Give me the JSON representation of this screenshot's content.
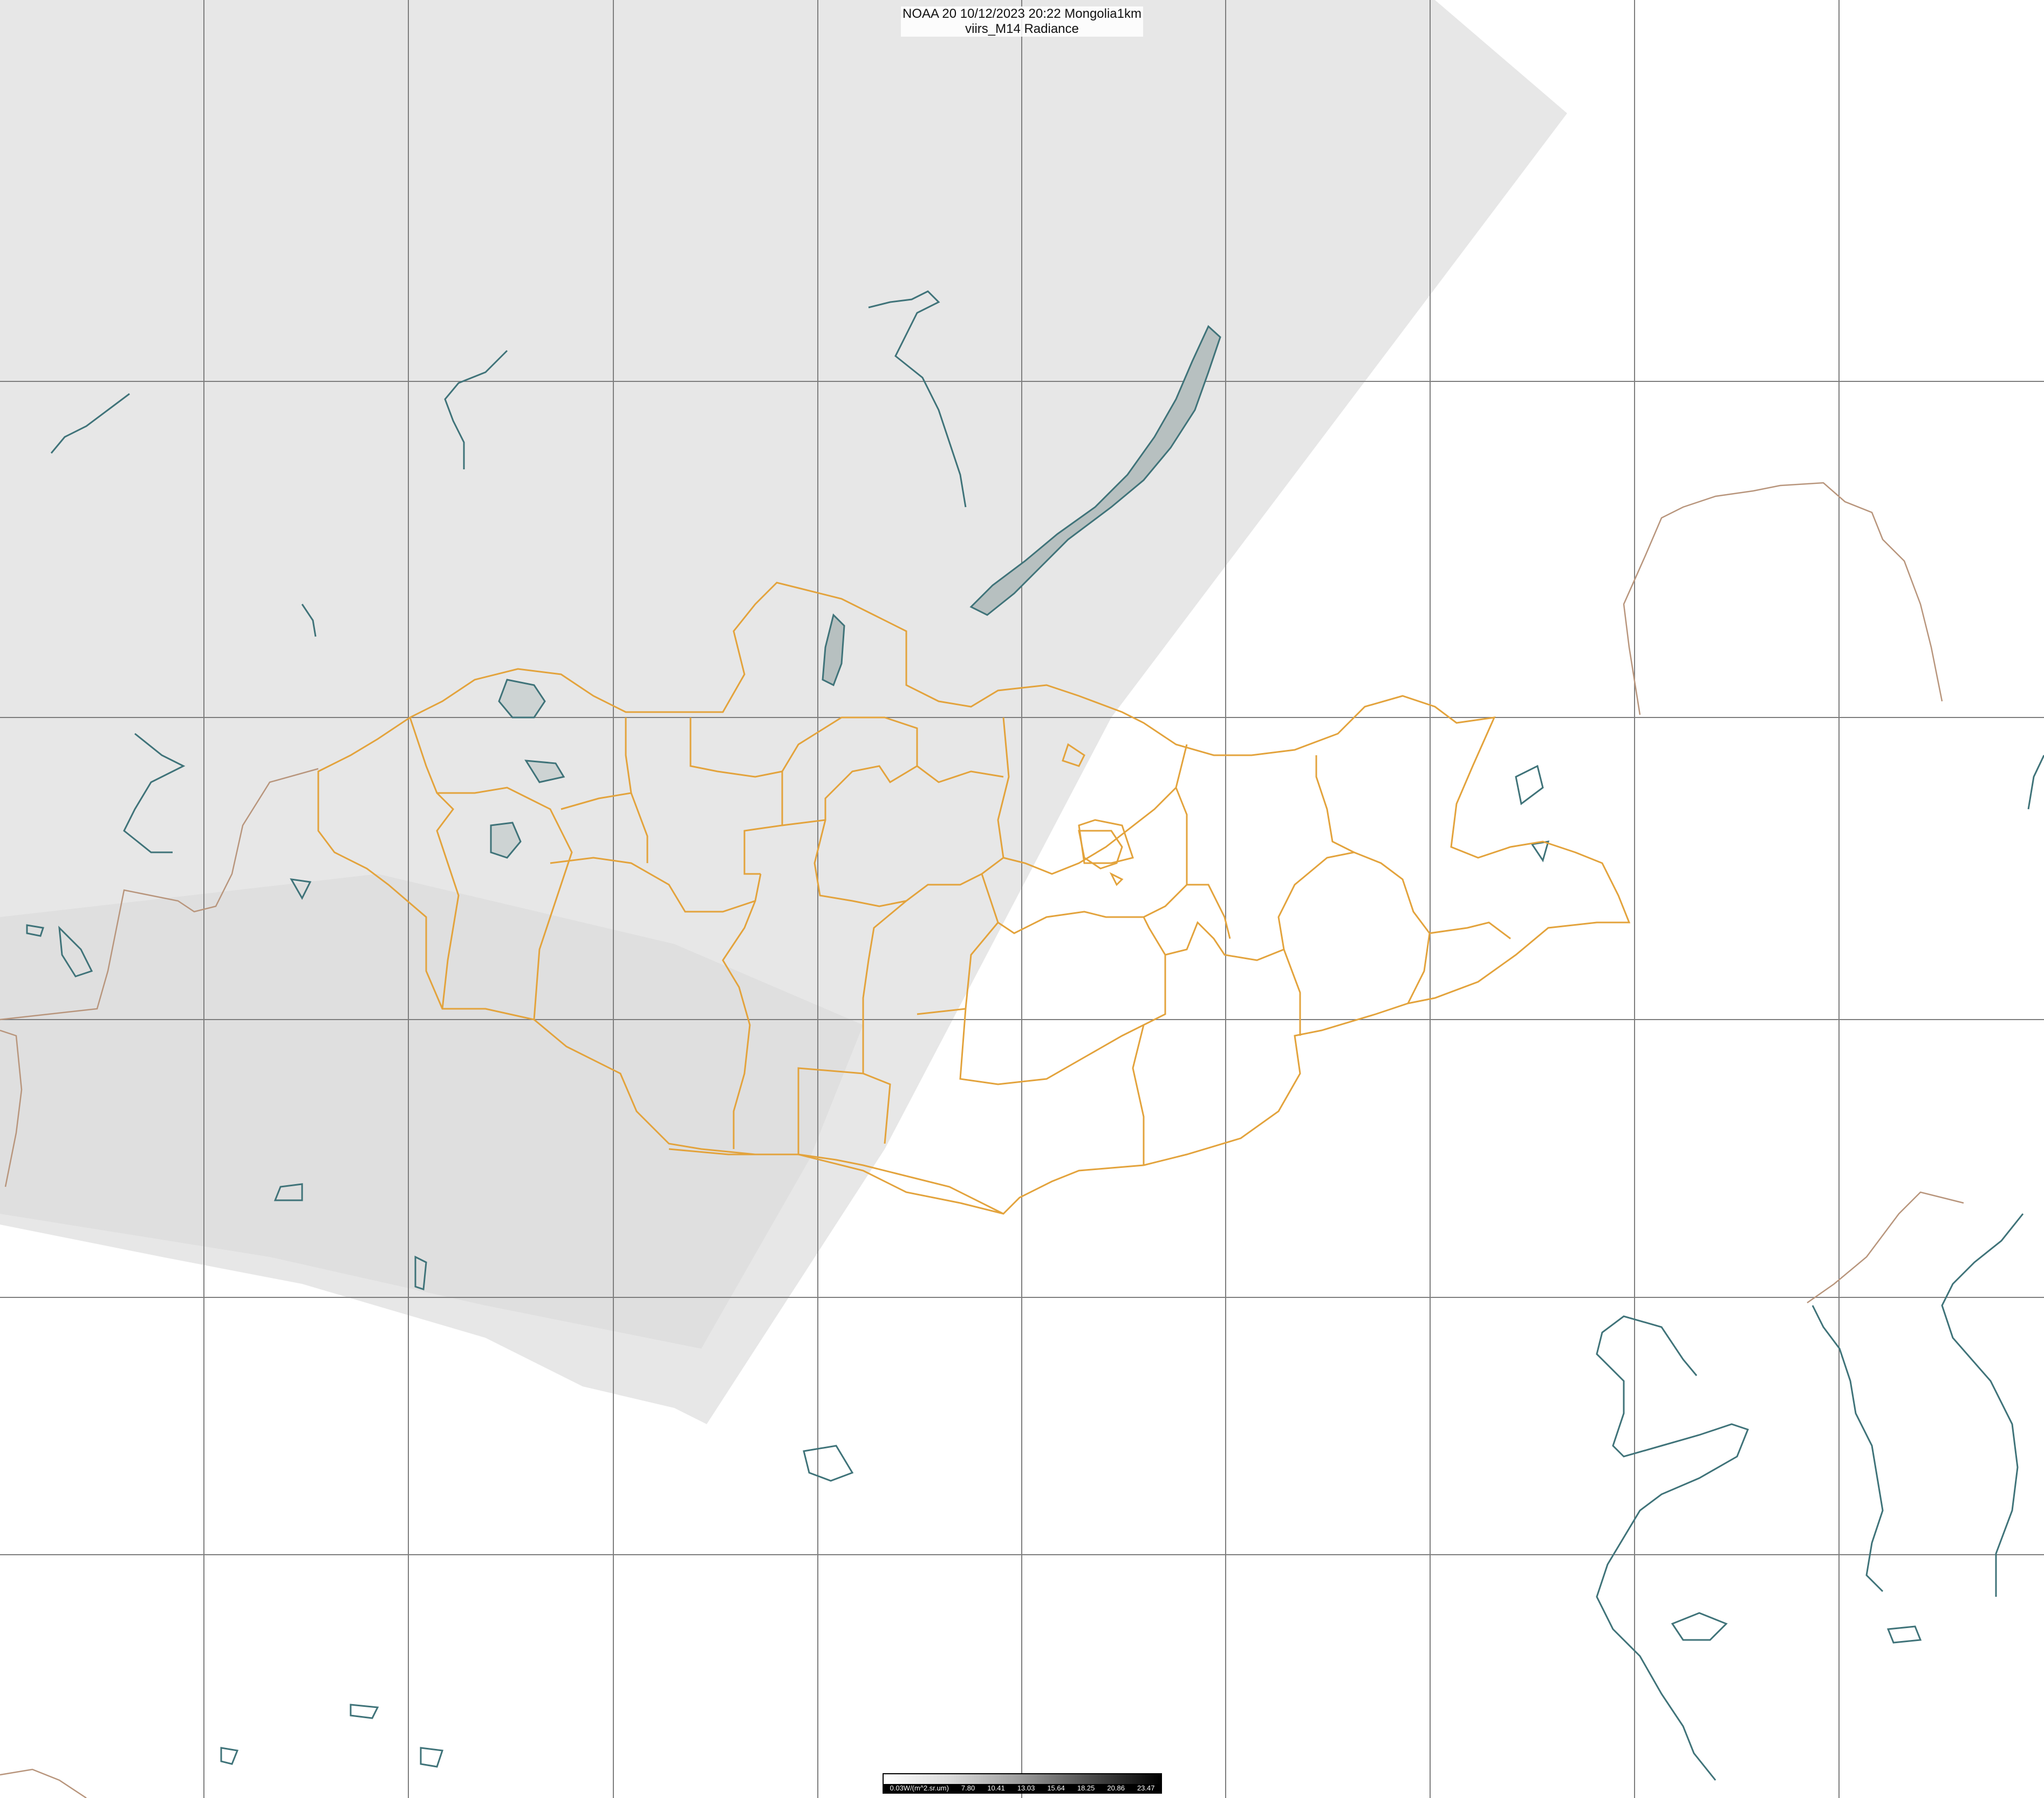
{
  "title": {
    "line1": "NOAA 20 10/12/2023 20:22 Mongolia1km",
    "line2": "viirs_M14 Radiance"
  },
  "colorbar": {
    "unit_label": "0.03W/(m^2.sr.um)",
    "ticks": [
      "7.80",
      "10.41",
      "13.03",
      "15.64",
      "18.25",
      "20.86",
      "23.47"
    ]
  },
  "colors": {
    "grid": "#7d7d7d",
    "swath": "#e6e6e6",
    "province_border": "#e3a33c",
    "coastline": "#3f7379",
    "country_border": "#b8957c"
  },
  "icons": {
    "map_layers": [
      "lat-lon-grid",
      "satellite-swath",
      "coastlines-lakes",
      "mongolia-province-borders",
      "country-borders"
    ]
  }
}
